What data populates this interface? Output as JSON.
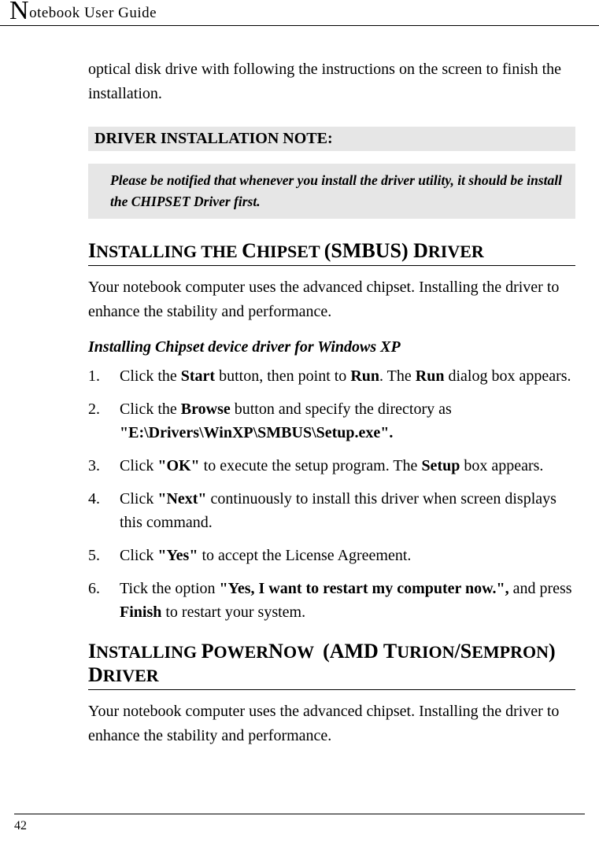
{
  "header": {
    "title_prefix": "N",
    "title_rest": "otebook User Guide"
  },
  "partial_para": "optical disk drive with following the instructions on the screen to finish the installation.",
  "note_heading": "DRIVER INSTALLATION NOTE:",
  "note_symbol": "",
  "note_text": "Please be notified that whenever you install the driver utility, it should be install the CHIPSET Driver first.",
  "section1_heading": "Installing the Chipset (SMBUS) Driver",
  "section1_para": "Your notebook computer uses the advanced chipset. Installing the driver to enhance the stability and performance.",
  "sub_heading": "Installing Chipset device driver for Windows XP",
  "steps": [
    "Click the <b>Start</b> button, then point to <b>Run</b>. The <b>Run</b> dialog box appears.",
    "Click the <b>Browse</b> button and specify the directory as <b>\"E:\\Drivers\\WinXP\\SMBUS\\Setup.exe\".</b>",
    "Click <b>\"OK\"</b> to execute the setup program. The <b>Setup</b> box appears.",
    "Click <b>\"Next\"</b> continuously to install this driver when screen displays this command.",
    "Click <b>\"Yes\"</b> to accept the License Agreement.",
    "Tick the option <b>\"Yes, I want to restart my computer now.\",</b> and press <b>Finish</b> to restart your system."
  ],
  "section2_heading": "Installing PowerNow  (AMD Turion/Sempron) Driver",
  "section2_para": "Your notebook computer uses the advanced chipset. Installing the driver to enhance the stability and performance.",
  "page_number": "42"
}
